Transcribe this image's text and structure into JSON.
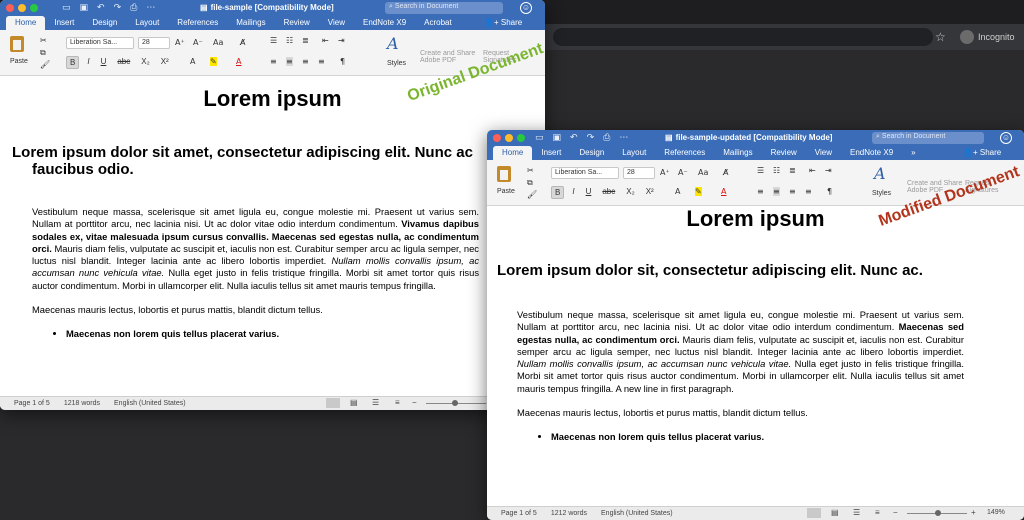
{
  "background": {
    "star_icon": "star-icon",
    "incognito_label": "Incognito"
  },
  "ribbon_common": {
    "tabs": [
      "Home",
      "Insert",
      "Design",
      "Layout",
      "References",
      "Mailings",
      "Review",
      "View",
      "EndNote X9",
      "Acrobat"
    ],
    "share_label": "Share",
    "search_placeholder": "Search in Document",
    "paste_label": "Paste",
    "font_name": "Liberation Sa...",
    "font_size": "28",
    "styles_label": "Styles",
    "create_share_label": "Create and Share Adobe PDF",
    "request_signatures_label": "Request Signatures",
    "format_buttons": [
      "B",
      "I",
      "U",
      "abc",
      "X₂",
      "X²"
    ]
  },
  "original": {
    "window_title": "file-sample [Compatibility Mode]",
    "stamp": "Original Document",
    "stamp_color": "#7bb52f",
    "doc": {
      "h1": "Lorem ipsum",
      "h2": "Lorem ipsum dolor sit amet, consectetur adipiscing elit. Nunc ac faucibus odio.",
      "p1_a": "Vestibulum neque massa, scelerisque sit amet ligula eu, congue molestie mi. Praesent ut varius sem. Nullam at porttitor arcu, nec lacinia nisi. Ut ac dolor vitae odio interdum condimentum. ",
      "p1_b": "Vivamus dapibus sodales ex, vitae malesuada ipsum cursus convallis. Maecenas sed egestas nulla, ac condimentum orci.",
      "p1_c": " Mauris diam felis, vulputate ac suscipit et, iaculis non est. Curabitur semper arcu ac ligula semper, nec luctus nisl blandit. Integer lacinia ante ac libero lobortis imperdiet. ",
      "p1_d": "Nullam mollis convallis ipsum, ac accumsan nunc vehicula vitae.",
      "p1_e": " Nulla eget justo in felis tristique fringilla. Morbi sit amet tortor quis risus auctor condimentum. Morbi in ullamcorper elit. Nulla iaculis tellus sit amet mauris tempus fringilla.",
      "p2": "Maecenas mauris lectus, lobortis et purus mattis, blandit dictum tellus.",
      "li1": "Maecenas non lorem quis tellus placerat varius."
    },
    "status": {
      "page": "Page 1 of 5",
      "words": "1218 words",
      "language": "English (United States)"
    }
  },
  "modified": {
    "window_title": "file-sample-updated [Compatibility Mode]",
    "tabs_trimmed": [
      "Home",
      "Insert",
      "Design",
      "Layout",
      "References",
      "Mailings",
      "Review",
      "View",
      "EndNote X9"
    ],
    "stamp": "Modified Document",
    "stamp_color": "#b3341c",
    "doc": {
      "h1": "Lorem ipsum",
      "h2": "Lorem ipsum dolor sit, consectetur adipiscing elit. Nunc ac.",
      "p1_a": "Vestibulum neque massa, scelerisque sit amet ligula eu, congue molestie mi. Praesent ut varius sem. Nullam at porttitor arcu, nec lacinia nisi. Ut ac dolor vitae odio interdum condimentum. ",
      "p1_b": "Maecenas sed egestas nulla, ac condimentum orci.",
      "p1_c": " Mauris diam felis, vulputate ac suscipit et, iaculis non est. Curabitur semper arcu ac ligula semper, nec luctus nisl blandit. Integer lacinia ante ac libero lobortis imperdiet. ",
      "p1_d": "Nullam mollis convallis ipsum, ac accumsan nunc vehicula vitae.",
      "p1_e": " Nulla eget justo in felis tristique fringilla. Morbi sit amet tortor quis risus auctor condimentum. Morbi in ullamcorper elit. Nulla iaculis tellus sit amet mauris tempus fringilla. A new line in first paragraph.",
      "p2": "Maecenas mauris lectus, lobortis et purus mattis, blandit dictum tellus.",
      "li1": "Maecenas non lorem quis tellus placerat varius."
    },
    "status": {
      "page": "Page 1 of 5",
      "words": "1212 words",
      "language": "English (United States)",
      "zoom": "149%"
    }
  }
}
